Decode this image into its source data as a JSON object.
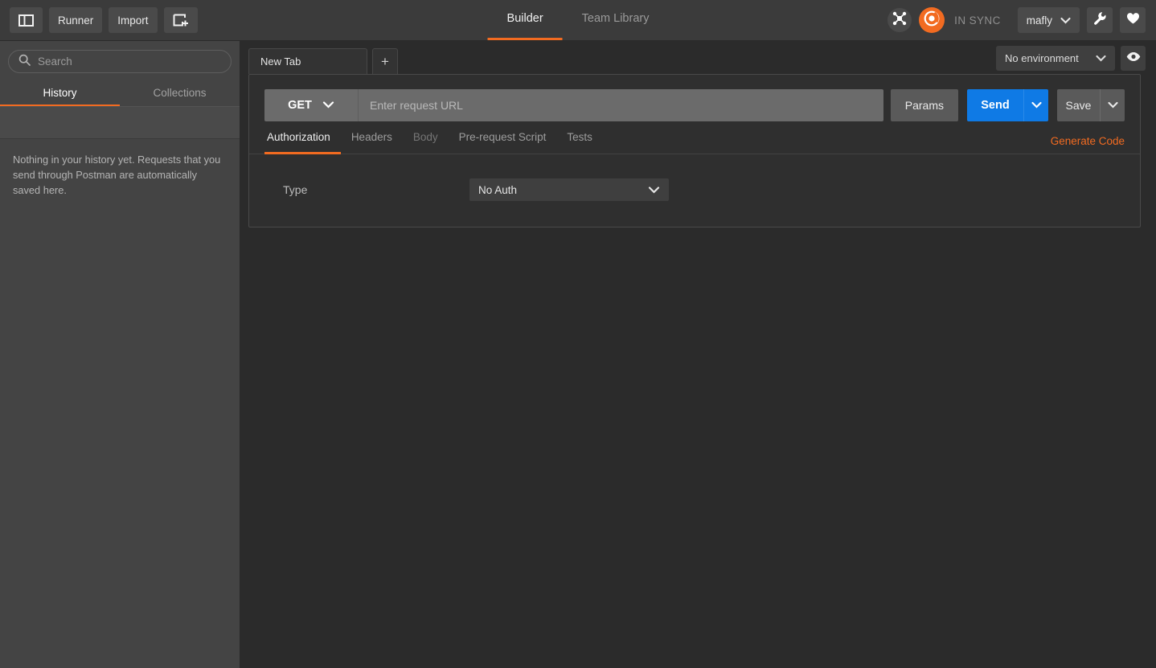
{
  "topbar": {
    "sidebar_toggle_icon": "sidebar-panel-icon",
    "runner_label": "Runner",
    "import_label": "Import",
    "new_window_icon": "new-window-plus-icon",
    "nav_tabs": [
      {
        "label": "Builder",
        "active": true
      },
      {
        "label": "Team Library",
        "active": false
      }
    ],
    "interceptor_icon": "interceptor-icon",
    "sync_icon": "postman-sync-icon",
    "sync_status": "IN SYNC",
    "user_name": "mafly",
    "user_caret_icon": "chevron-down-icon",
    "settings_icon": "wrench-icon",
    "favorites_icon": "heart-icon"
  },
  "sidebar": {
    "search_placeholder": "Search",
    "search_value": "",
    "search_icon": "search-icon",
    "tabs": [
      {
        "label": "History",
        "active": true
      },
      {
        "label": "Collections",
        "active": false
      }
    ],
    "empty_message": "Nothing in your history yet. Requests that you send through Postman are automatically saved here."
  },
  "main": {
    "request_tabs": [
      {
        "label": "New Tab",
        "active": true
      }
    ],
    "add_tab_label": "+",
    "environment": {
      "selected": "No environment",
      "caret_icon": "chevron-down-icon",
      "eye_icon": "eye-icon"
    },
    "request": {
      "method": "GET",
      "method_caret_icon": "chevron-down-icon",
      "url_placeholder": "Enter request URL",
      "url_value": "",
      "params_label": "Params",
      "send_label": "Send",
      "send_caret_icon": "chevron-down-icon",
      "save_label": "Save",
      "save_caret_icon": "chevron-down-icon"
    },
    "request_tabs_row": [
      {
        "label": "Authorization",
        "active": true,
        "dim": false
      },
      {
        "label": "Headers",
        "active": false,
        "dim": false
      },
      {
        "label": "Body",
        "active": false,
        "dim": true
      },
      {
        "label": "Pre-request Script",
        "active": false,
        "dim": false
      },
      {
        "label": "Tests",
        "active": false,
        "dim": false
      }
    ],
    "generate_code_label": "Generate Code",
    "authorization": {
      "type_label": "Type",
      "type_value": "No Auth",
      "type_caret_icon": "chevron-down-icon"
    }
  },
  "colors": {
    "accent_orange": "#f26b21",
    "send_blue": "#0f7ae5",
    "topbar_bg": "#3b3b3b",
    "sidebar_bg": "#444444",
    "main_bg": "#2b2b2b"
  }
}
